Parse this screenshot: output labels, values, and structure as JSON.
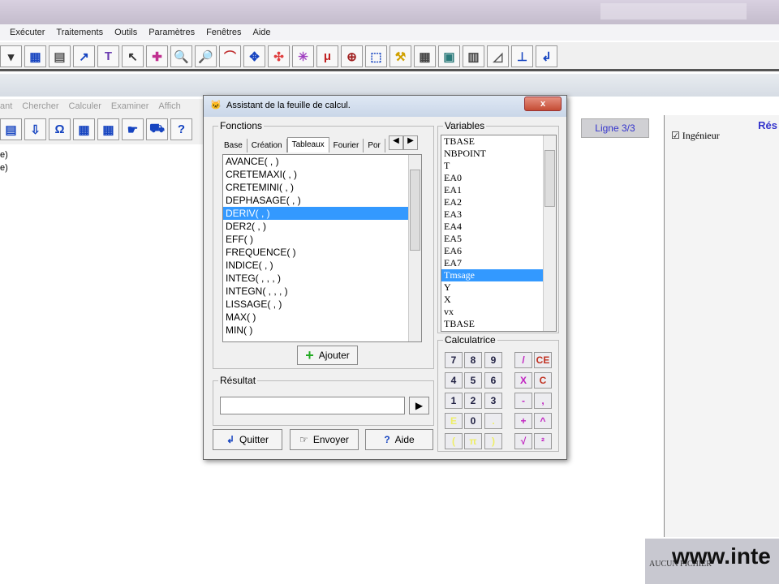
{
  "menu": [
    "Exécuter",
    "Traitements",
    "Outils",
    "Paramètres",
    "Fenêtres",
    "Aide"
  ],
  "menu2": [
    "ant",
    "Chercher",
    "Calculer",
    "Examiner",
    "Affich"
  ],
  "left_lines": [
    "e)",
    "e)"
  ],
  "status": {
    "line": "Ligne 3/3",
    "right_title": "Rés",
    "checkbox_label": "Ingénieur",
    "status_text": "AUCUN FICHIER",
    "watermark": "www.inte"
  },
  "dialog": {
    "title": "Assistant de la feuille de calcul.",
    "close": "x",
    "functions_label": "Fonctions",
    "tabs": [
      "Base",
      "Création",
      "Tableaux",
      "Fourier",
      "Por"
    ],
    "functions": [
      "AVANCE( , )",
      "CRETEMAXI( , )",
      "CRETEMINI( , )",
      "DEPHASAGE( , )",
      "DERIV( , )",
      "DER2( , )",
      "EFF( )",
      "FREQUENCE( )",
      "INDICE( , )",
      "INTEG( , , , )",
      "INTEGN( , , , )",
      "LISSAGE( , )",
      "MAX( )",
      "MIN( )"
    ],
    "selected_function": "DERIV( , )",
    "add": "Ajouter",
    "result_label": "Résultat",
    "result_value": "",
    "variables_label": "Variables",
    "variables": [
      "TBASE",
      "NBPOINT",
      "T",
      "EA0",
      "EA1",
      "EA2",
      "EA3",
      "EA4",
      "EA5",
      "EA6",
      "EA7",
      "Tmsage",
      "Y",
      "X",
      "vx",
      "TBASE"
    ],
    "selected_variable": "Tmsage",
    "calc_label": "Calculatrice",
    "calc_keys": [
      [
        "7",
        "8",
        "9",
        "/",
        "CE"
      ],
      [
        "4",
        "5",
        "6",
        "X",
        "C"
      ],
      [
        "1",
        "2",
        "3",
        "-",
        ","
      ],
      [
        "E",
        "0",
        ".",
        "+",
        "^"
      ],
      [
        "(",
        "π",
        ")",
        "√",
        "²"
      ]
    ],
    "quit": "Quitter",
    "send": "Envoyer",
    "help": "Aide"
  }
}
